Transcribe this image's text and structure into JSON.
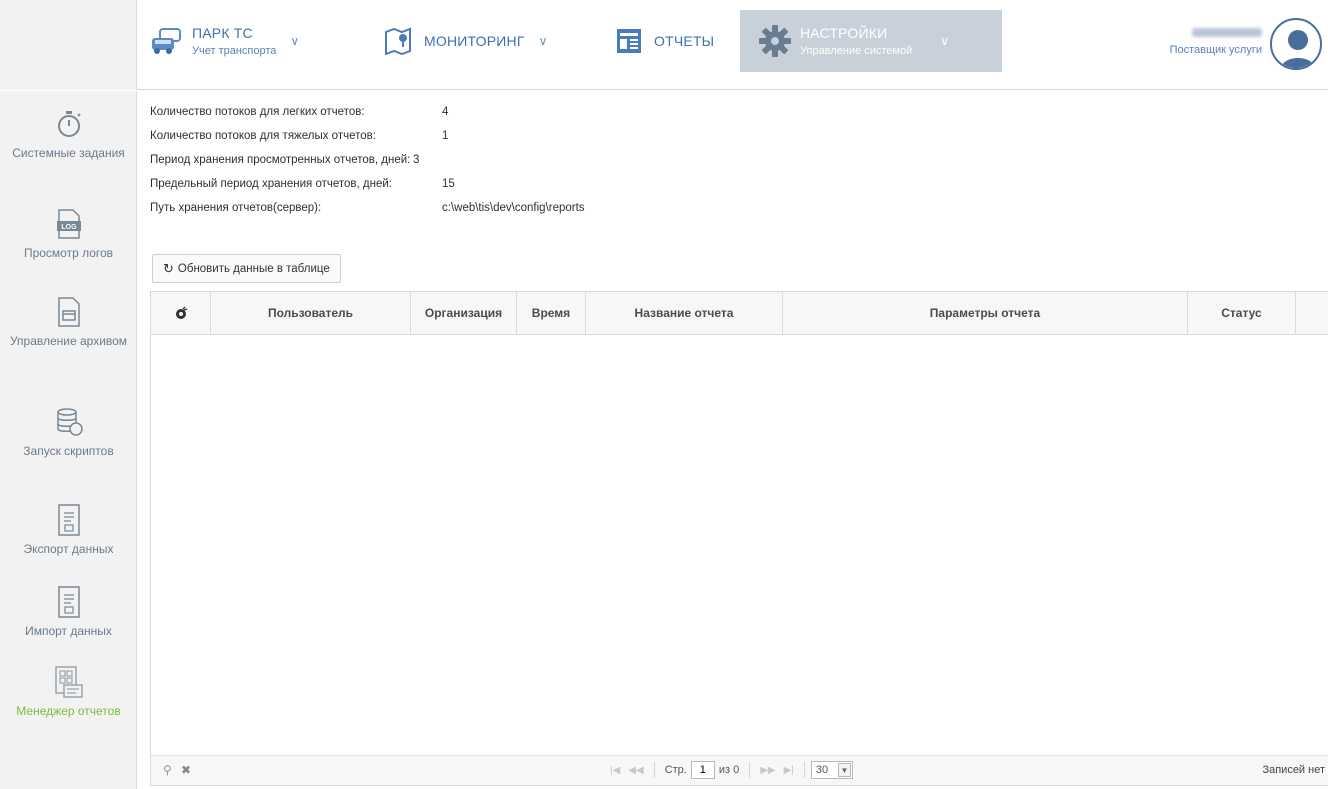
{
  "nav": {
    "park": {
      "title": "ПАРК ТС",
      "subtitle": "Учет транспорта"
    },
    "monitoring": {
      "title": "МОНИТОРИНГ"
    },
    "reports": {
      "title": "ОТЧЕТЫ"
    },
    "settings": {
      "title": "НАСТРОЙКИ",
      "subtitle": "Управление системой"
    }
  },
  "user": {
    "role": "Поставщик услуги"
  },
  "sidebar": {
    "items": [
      {
        "label": "Системные задания"
      },
      {
        "label": "Просмотр логов"
      },
      {
        "label": "Управление архивом"
      },
      {
        "label": "Запуск скриптов"
      },
      {
        "label": "Экспорт данных"
      },
      {
        "label": "Импорт данных"
      },
      {
        "label": "Менеджер отчетов"
      }
    ]
  },
  "info": [
    {
      "key": "Количество потоков для легких отчетов:",
      "value": "4"
    },
    {
      "key": "Количество потоков для тяжелых отчетов:",
      "value": "1"
    },
    {
      "key": "Период хранения просмотренных отчетов, дней:",
      "value": "3"
    },
    {
      "key": "Предельный период хранения отчетов, дней:",
      "value": "15"
    },
    {
      "key": "Путь хранения отчетов(сервер):",
      "value": "c:\\web\\tis\\dev\\config\\reports"
    }
  ],
  "refresh_label": "Обновить данные в таблице",
  "grid": {
    "columns": [
      "",
      "Пользователь",
      "Организация",
      "Время",
      "Название отчета",
      "Параметры отчета",
      "Статус"
    ],
    "rows": []
  },
  "pager": {
    "page_label": "Стр.",
    "page": "1",
    "of_label": "из 0",
    "page_size": "30",
    "records": "Записей нет"
  },
  "colors": {
    "accent": "#3f6fb3",
    "active_nav_bg": "#c8d0d9",
    "active_side": "#7cbd3a",
    "sidebar_bg": "#f2f2f2"
  }
}
